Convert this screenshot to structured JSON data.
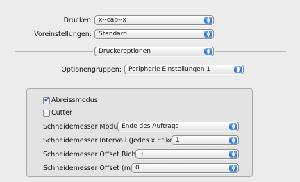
{
  "printer": {
    "label": "Drucker:",
    "value": "x--cab--x"
  },
  "presets": {
    "label": "Voreinstellungen:",
    "value": "Standard"
  },
  "panel_selector": {
    "value": "Druckeroptionen"
  },
  "option_groups": {
    "label": "Optionengruppen:",
    "value": "Peripherie Einstellungen 1"
  },
  "options": {
    "tear_off": {
      "label": "Abreissmodus",
      "checked": true
    },
    "cutter": {
      "label": "Cutter",
      "checked": false
    },
    "cut_mode": {
      "label": "Schneidemesser Modus:",
      "value": "Ende des Auftrags"
    },
    "cut_interval": {
      "label": "Schneidemesser Intervall (Jedes x Etikett):",
      "value": "1"
    },
    "cut_offset_direction": {
      "label": "Schneidemesser Offset Richtung:",
      "value": "+"
    },
    "cut_offset_mm": {
      "label": "Schneidemesser Offset (mm):",
      "value": "0"
    }
  }
}
